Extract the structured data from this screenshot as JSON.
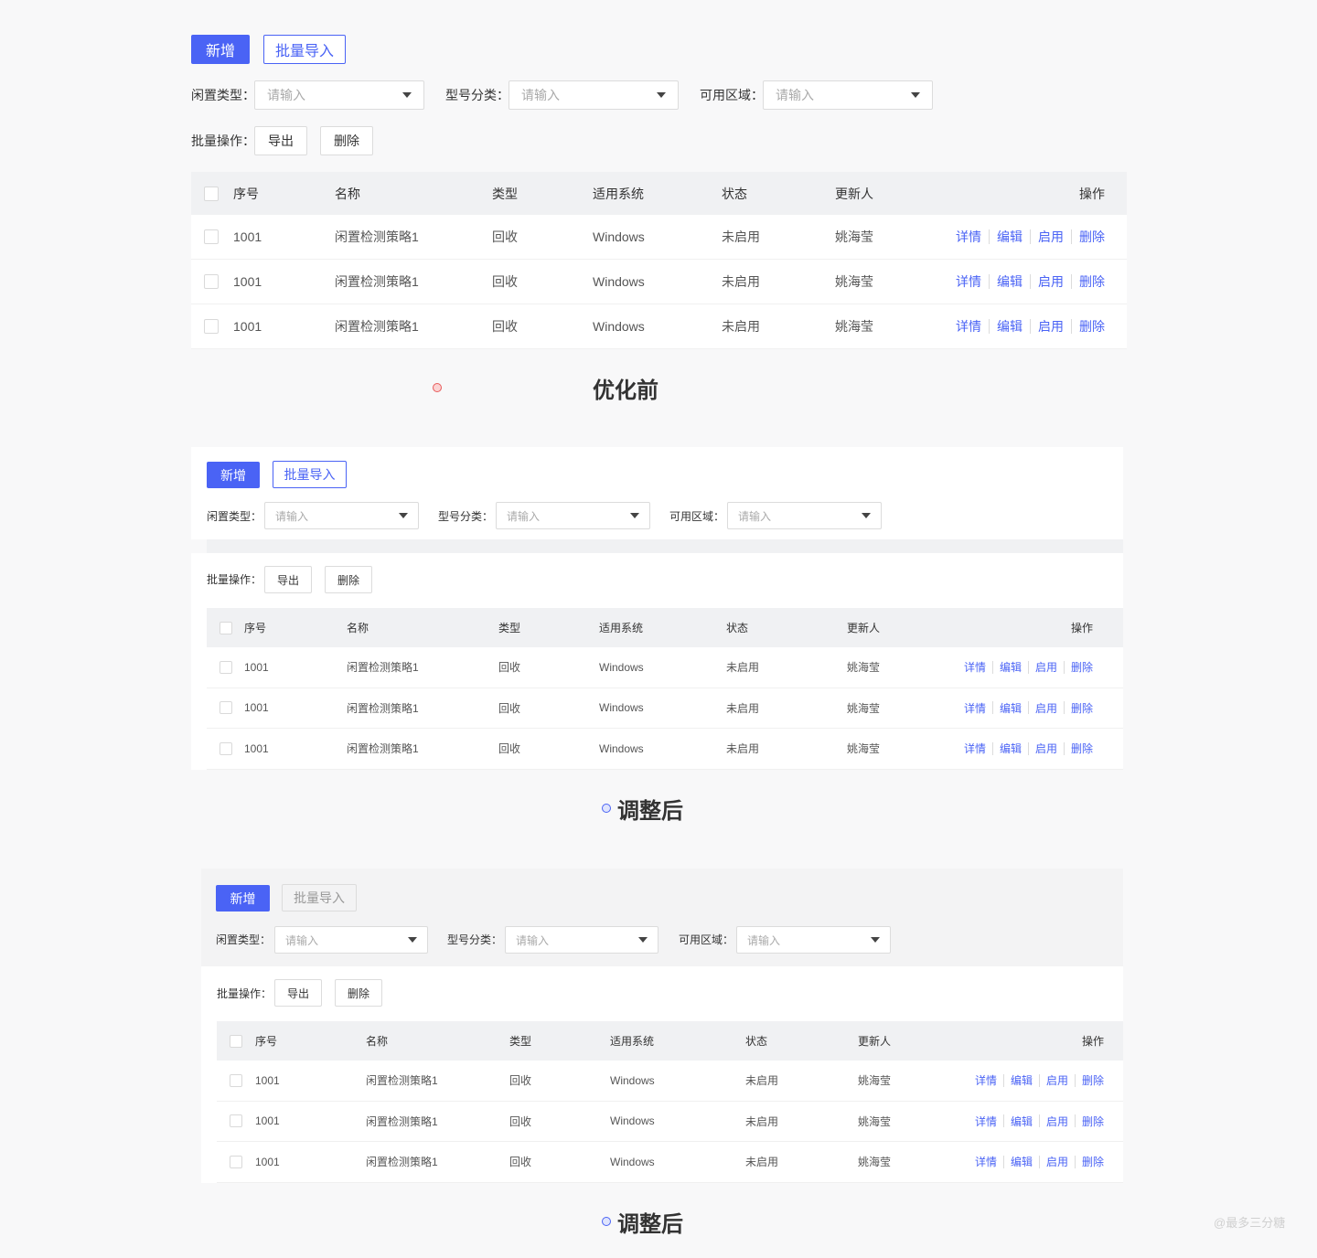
{
  "actions": {
    "add_label": "新增",
    "import_label": "批量导入"
  },
  "filters": {
    "idle_type_label": "闲置类型：",
    "model_category_label": "型号分类：",
    "available_area_label": "可用区域：",
    "placeholder": "请输入"
  },
  "batch": {
    "label": "批量操作：",
    "export_label": "导出",
    "delete_label": "删除"
  },
  "table": {
    "columns": [
      "序号",
      "名称",
      "类型",
      "适用系统",
      "状态",
      "更新人",
      "操作"
    ],
    "rows": [
      [
        "1001",
        "闲置检测策略1",
        "回收",
        "Windows",
        "未启用",
        "姚海莹"
      ],
      [
        "1001",
        "闲置检测策略1",
        "回收",
        "Windows",
        "未启用",
        "姚海莹"
      ],
      [
        "1001",
        "闲置检测策略1",
        "回收",
        "Windows",
        "未启用",
        "姚海莹"
      ]
    ],
    "row_actions": [
      "详情",
      "编辑",
      "启用",
      "删除"
    ]
  },
  "captions": {
    "before": "优化前",
    "after1": "调整后",
    "after2": "调整后"
  },
  "watermark": "@最多三分糖",
  "colors": {
    "primary": "#4a63f5",
    "header_bg": "#f0f1f3",
    "page_bg": "#f8f8f9",
    "red_dot": "#e85a5a",
    "blue_dot": "#4a63f5"
  }
}
